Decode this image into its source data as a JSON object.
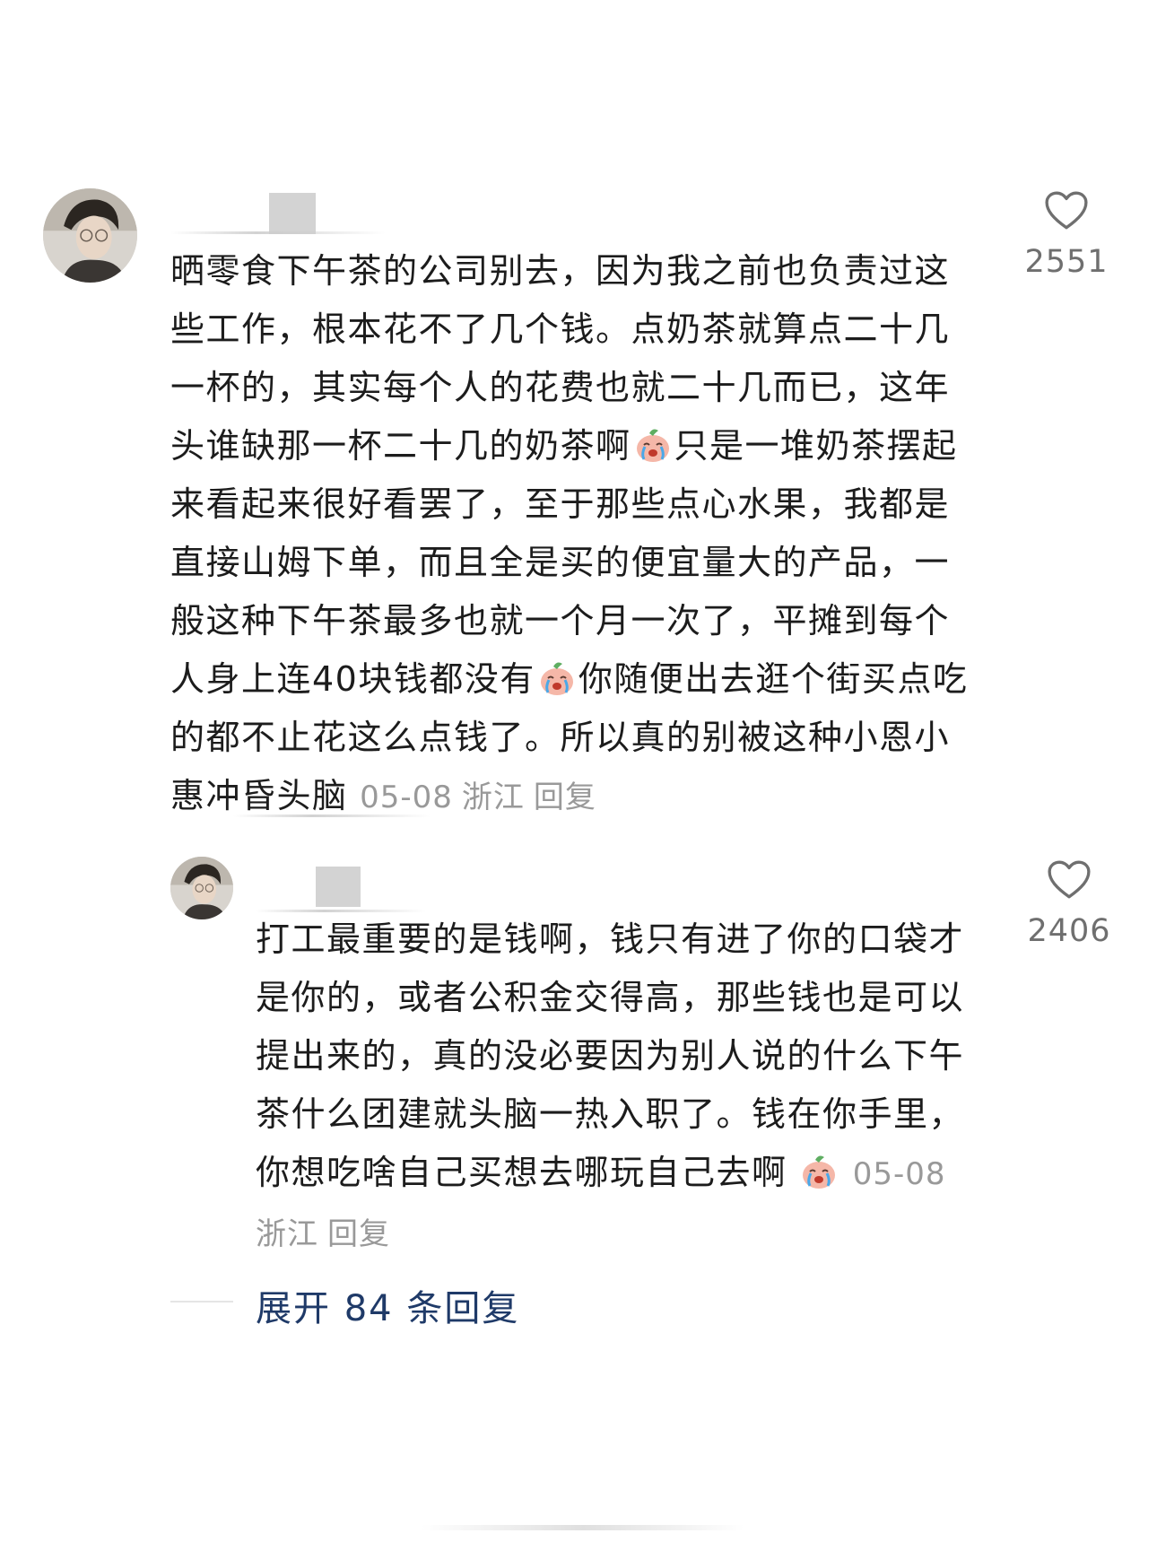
{
  "comments": [
    {
      "text_parts": [
        "晒零食下午茶的公司别去，因为我之前也负责过这些工作，根本花不了几个钱。点奶茶就算点二十几一杯的，其实每个人的花费也就二十几而已，这年头谁缺那一杯二十几的奶茶啊",
        "只是一堆奶茶摆起来看起来很好看罢了，至于那些点心水果，我都是直接山姆下单，而且全是买的便宜量大的产品，一般这种下午茶最多也就一个月一次了，平摊到每个人身上连40块钱都没有",
        "你随便出去逛个街买点吃的都不止花这么点钱了。所以真的别被这种小恩小惠冲昏头脑"
      ],
      "date": "05-08",
      "location": "浙江",
      "reply_label": "回复",
      "likes": "2551",
      "emoji_icon": "crying-peach-emoji"
    },
    {
      "text_parts": [
        "打工最重要的是钱啊，钱只有进了你的口袋才是你的，或者公积金交得高，那些钱也是可以提出来的，真的没必要因为别人说的什么下午茶什么团建就头脑一热入职了。钱在你手里，你想吃啥自己买想去哪玩自己去啊"
      ],
      "date": "05-08",
      "location": "浙江",
      "reply_label": "回复",
      "likes": "2406",
      "emoji_icon": "crying-peach-emoji"
    }
  ],
  "expand_replies": "展开 84 条回复",
  "colors": {
    "text": "#1c1c1c",
    "meta": "#999999",
    "like_count": "#6f6f6f",
    "expand_link": "#1f3a68"
  },
  "icons": {
    "like": "heart-outline-icon",
    "avatar": "user-avatar-photo"
  }
}
